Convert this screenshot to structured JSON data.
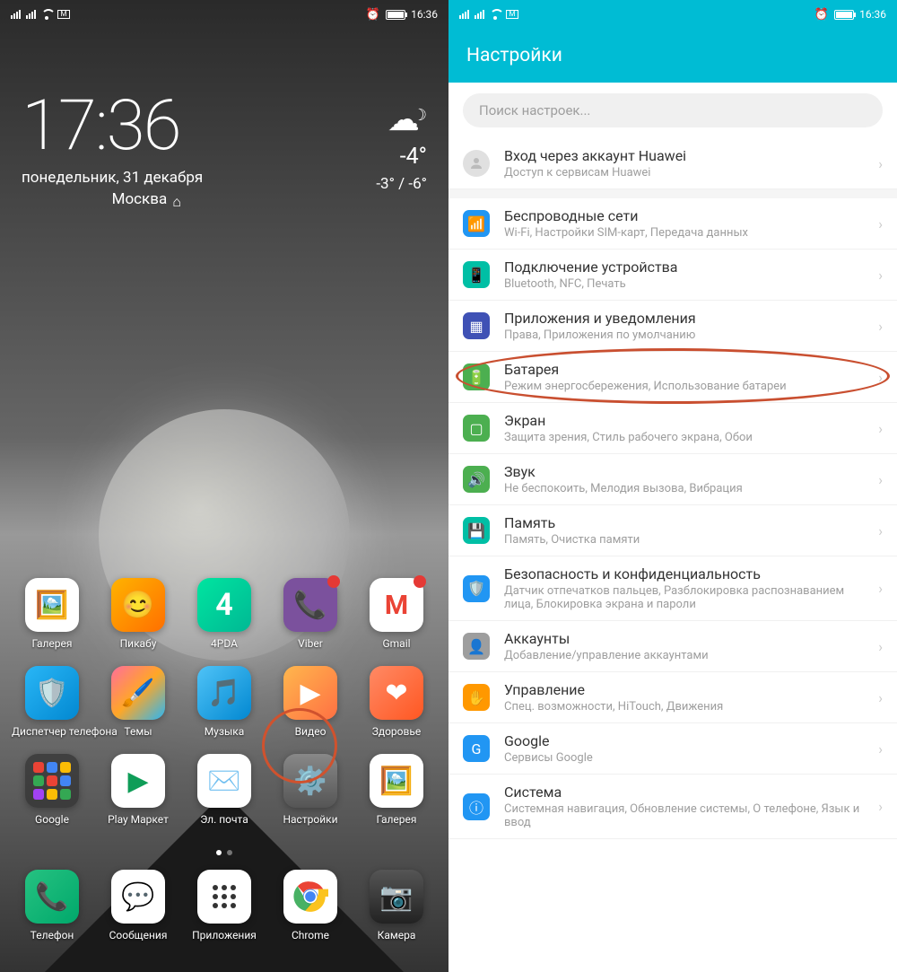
{
  "status": {
    "time": "16:36",
    "mail": "M",
    "alarm": "⏰"
  },
  "home": {
    "clock": {
      "time": "17:36",
      "date": "понедельник, 31 декабря",
      "city": "Москва"
    },
    "weather": {
      "temp": "-4°",
      "range": "-3° / -6°"
    },
    "rows": [
      [
        {
          "name": "gallery",
          "label": "Галерея",
          "bg": "#fff",
          "emoji": "🖼️"
        },
        {
          "name": "pikabu",
          "label": "Пикабу",
          "bg": "linear-gradient(135deg,#ffb300,#ff6f00)",
          "emoji": "😊"
        },
        {
          "name": "4pda",
          "label": "4PDA",
          "bg": "linear-gradient(135deg,#00e5a0,#00b894)",
          "emoji": "4"
        },
        {
          "name": "viber",
          "label": "Viber",
          "bg": "#7b519d",
          "emoji": "📞",
          "badge": ""
        },
        {
          "name": "gmail",
          "label": "Gmail",
          "bg": "#fff",
          "emoji": "M",
          "color": "#ea4335",
          "badge": ""
        }
      ],
      [
        {
          "name": "phone-manager",
          "label": "Диспетчер телефона",
          "bg": "linear-gradient(135deg,#29b6f6,#0288d1)",
          "emoji": "🛡️"
        },
        {
          "name": "themes",
          "label": "Темы",
          "bg": "linear-gradient(135deg,#ff6e9c,#ffa726,#29b6f6)",
          "emoji": "🖌️"
        },
        {
          "name": "music",
          "label": "Музыка",
          "bg": "linear-gradient(135deg,#4fc3f7,#0288d1)",
          "emoji": "🎵"
        },
        {
          "name": "video",
          "label": "Видео",
          "bg": "linear-gradient(135deg,#ffb74d,#ff7043)",
          "emoji": "▶"
        },
        {
          "name": "health",
          "label": "Здоровье",
          "bg": "linear-gradient(135deg,#ff8a65,#ff5722)",
          "emoji": "❤"
        }
      ],
      [
        {
          "name": "google-folder",
          "label": "Google",
          "folder": true
        },
        {
          "name": "play",
          "label": "Play Маркет",
          "bg": "#fff",
          "emoji": "▶",
          "color": "#0f9d58"
        },
        {
          "name": "email",
          "label": "Эл. почта",
          "bg": "#fff",
          "emoji": "✉️"
        },
        {
          "name": "settings-app",
          "label": "Настройки",
          "bg": "linear-gradient(180deg,#888,#555)",
          "emoji": "⚙️"
        },
        {
          "name": "gallery2",
          "label": "Галерея",
          "bg": "#fff",
          "emoji": "🖼️"
        }
      ]
    ],
    "dock": [
      {
        "name": "phone",
        "label": "Телефон",
        "bg": "linear-gradient(135deg,#26c281,#00a86b)",
        "emoji": "📞"
      },
      {
        "name": "messages",
        "label": "Сообщения",
        "bg": "#fff",
        "emoji": "💬",
        "color": "#1a73e8"
      },
      {
        "name": "apps",
        "label": "Приложения",
        "bg": "#fff",
        "emoji": "⋮⋮⋮",
        "color": "#333"
      },
      {
        "name": "chrome",
        "label": "Chrome",
        "bg": "#fff",
        "emoji": "◉"
      },
      {
        "name": "camera",
        "label": "Камера",
        "bg": "linear-gradient(180deg,#555,#222)",
        "emoji": "📷"
      }
    ]
  },
  "settings": {
    "title": "Настройки",
    "search": "Поиск настроек...",
    "account": {
      "title": "Вход через аккаунт Huawei",
      "sub": "Доступ к сервисам Huawei"
    },
    "items": [
      {
        "key": "wireless",
        "title": "Беспроводные сети",
        "sub": "Wi-Fi, Настройки SIM-карт, Передача данных",
        "color": "#2196f3",
        "emoji": "📶"
      },
      {
        "key": "device",
        "title": "Подключение устройства",
        "sub": "Bluetooth, NFC, Печать",
        "color": "#00bfa5",
        "emoji": "📱"
      },
      {
        "key": "apps",
        "title": "Приложения и уведомления",
        "sub": "Права, Приложения по умолчанию",
        "color": "#3f51b5",
        "emoji": "▦"
      },
      {
        "key": "battery",
        "title": "Батарея",
        "sub": "Режим энергосбережения, Использование батареи",
        "color": "#4caf50",
        "emoji": "🔋"
      },
      {
        "key": "screen",
        "title": "Экран",
        "sub": "Защита зрения, Стиль рабочего экрана, Обои",
        "color": "#4caf50",
        "emoji": "▢"
      },
      {
        "key": "sound",
        "title": "Звук",
        "sub": "Не беспокоить, Мелодия вызова, Вибрация",
        "color": "#4caf50",
        "emoji": "🔊"
      },
      {
        "key": "storage",
        "title": "Память",
        "sub": "Память, Очистка памяти",
        "color": "#00bfa5",
        "emoji": "💾"
      },
      {
        "key": "security",
        "title": "Безопасность и конфиденциальность",
        "sub": "Датчик отпечатков пальцев, Разблокировка распознаванием лица, Блокировка экрана и пароли",
        "color": "#2196f3",
        "emoji": "🛡️"
      },
      {
        "key": "accounts",
        "title": "Аккаунты",
        "sub": "Добавление/управление аккаунтами",
        "color": "#9e9e9e",
        "emoji": "👤"
      },
      {
        "key": "control",
        "title": "Управление",
        "sub": "Спец. возможности, HiTouch, Движения",
        "color": "#ff9800",
        "emoji": "✋"
      },
      {
        "key": "google",
        "title": "Google",
        "sub": "Сервисы Google",
        "color": "#2196f3",
        "emoji": "G"
      },
      {
        "key": "system",
        "title": "Система",
        "sub": "Системная навигация, Обновление системы, О телефоне, Язык и ввод",
        "color": "#2196f3",
        "emoji": "ⓘ"
      }
    ]
  }
}
